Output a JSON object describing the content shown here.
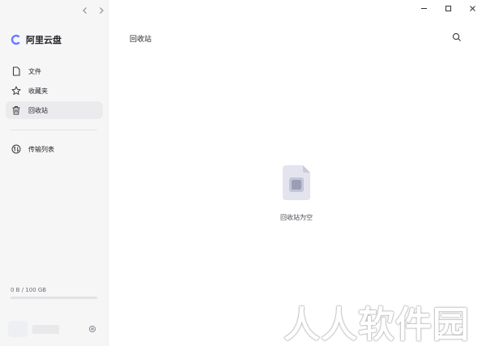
{
  "app": {
    "name": "阿里云盘"
  },
  "sidebar": {
    "items": [
      {
        "label": "文件",
        "icon": "file-icon"
      },
      {
        "label": "收藏夹",
        "icon": "star-icon"
      },
      {
        "label": "回收站",
        "icon": "trash-icon",
        "active": true
      },
      {
        "label": "传输列表",
        "icon": "transfer-icon"
      }
    ],
    "storage": {
      "text": "0 B / 100 GB",
      "used_fraction": 0
    }
  },
  "main": {
    "title": "回收站",
    "empty_text": "回收站为空"
  },
  "watermark": "人人软件园",
  "colors": {
    "accent": "#637dff",
    "sidebar_bg": "#f6f6f7",
    "active_bg": "#ebebed"
  }
}
